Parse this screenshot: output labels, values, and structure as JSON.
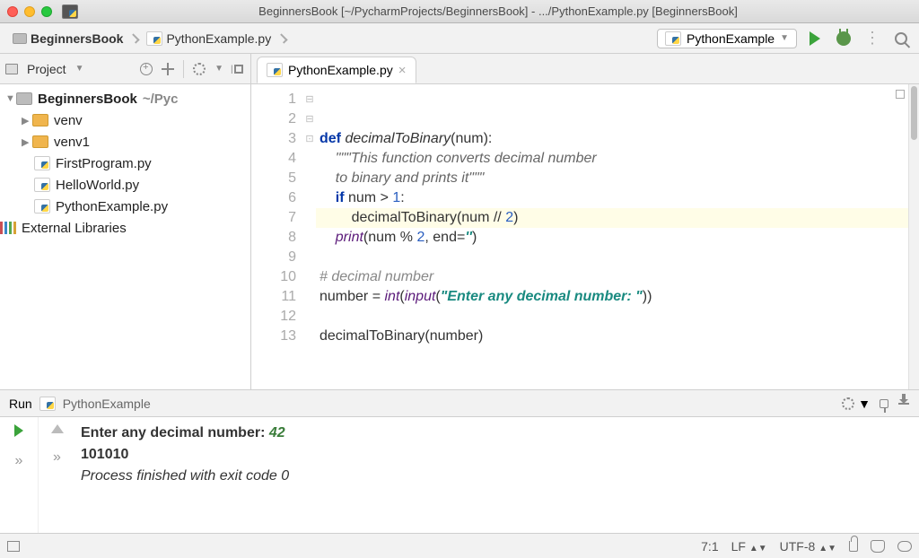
{
  "titlebar": {
    "title": "BeginnersBook [~/PycharmProjects/BeginnersBook] - .../PythonExample.py [BeginnersBook]"
  },
  "breadcrumb": {
    "items": [
      "BeginnersBook",
      "PythonExample.py"
    ]
  },
  "runconfig": {
    "label": "PythonExample"
  },
  "sidebar": {
    "toolbar_label": "Project",
    "root": {
      "name": "BeginnersBook",
      "path": "~/PycharmProjects/BeginnersBook"
    },
    "folders": [
      "venv",
      "venv1"
    ],
    "files": [
      "FirstProgram.py",
      "HelloWorld.py",
      "PythonExample.py"
    ],
    "external": "External Libraries"
  },
  "editor": {
    "tab_label": "PythonExample.py",
    "line_numbers": [
      "1",
      "2",
      "3",
      "4",
      "5",
      "6",
      "7",
      "8",
      "9",
      "10",
      "11",
      "12",
      "13"
    ],
    "fold_marks": [
      "⊟",
      "",
      "",
      "⊟",
      "",
      "⊡",
      "",
      "",
      "",
      "",
      "",
      "",
      ""
    ],
    "code_tokens": {
      "l1": {
        "def": "def",
        "name": "decimalToBinary",
        "paren": "(num):"
      },
      "l2": "\"\"\"This function converts decimal number",
      "l3": "to binary and prints it\"\"\"",
      "l4": {
        "if": "if",
        "rest": " num > ",
        "n": "1",
        "colon": ":"
      },
      "l5": {
        "call": "decimalToBinary(num // ",
        "n": "2",
        "close": ")"
      },
      "l6": {
        "print": "print",
        "open": "(num % ",
        "n": "2",
        "mid": ", end=",
        "s": "''",
        "close": ")"
      },
      "l9": "# decimal number",
      "l10": {
        "var": "number = ",
        "int": "int",
        "open": "(",
        "input": "input",
        "op2": "(",
        "s": "\"Enter any decimal number: \"",
        "close": "))"
      },
      "l12": "decimalToBinary(number)"
    }
  },
  "run_panel": {
    "header_text": "Run",
    "config_name": "PythonExample",
    "console": {
      "prompt": "Enter any decimal number: ",
      "user_input": "42",
      "output_line": "101010",
      "exit_msg": "Process finished with exit code 0"
    }
  },
  "statusbar": {
    "pos": "7:1",
    "lf": "LF",
    "enc": "UTF-8"
  }
}
